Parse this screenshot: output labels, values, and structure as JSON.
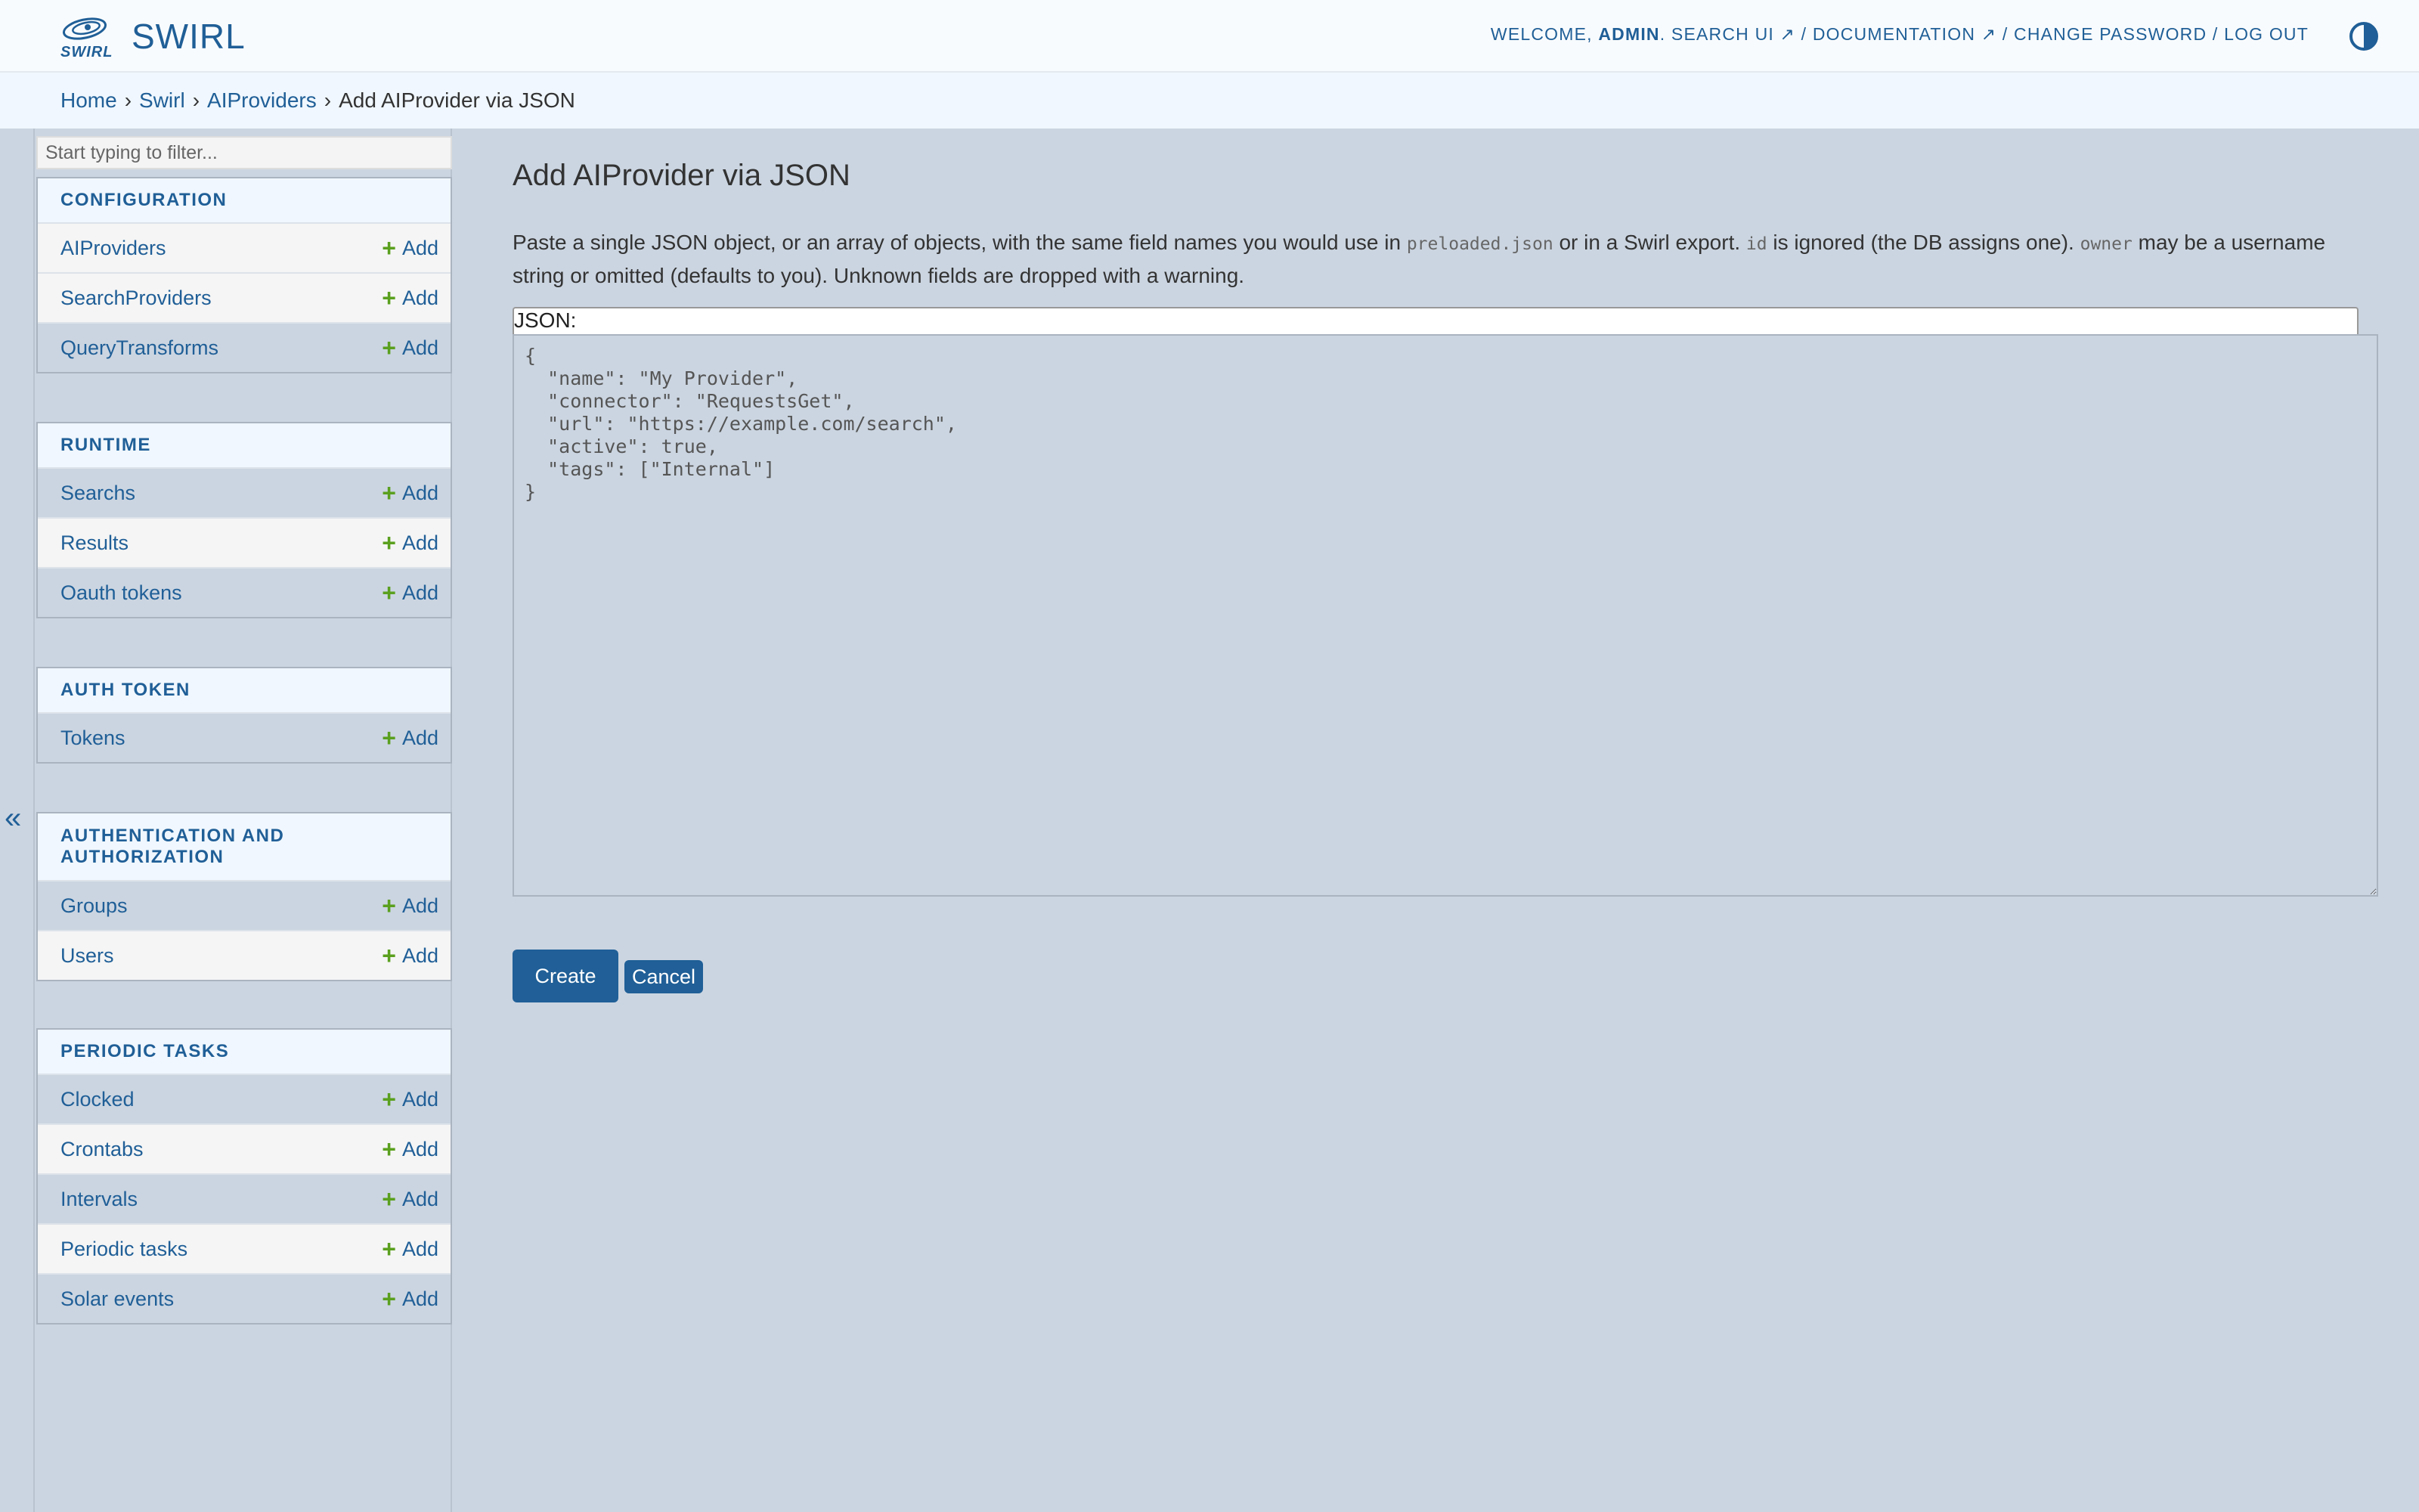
{
  "header": {
    "logo_text": "SWIRL",
    "site_title": "SWIRL",
    "welcome": "Welcome, ",
    "username": "admin",
    "search_ui": "Search UI ↗",
    "documentation": "Documentation ↗",
    "change_password": "Change password",
    "log_out": "Log out",
    "separator": " / "
  },
  "breadcrumbs": {
    "home": "Home",
    "app": "Swirl",
    "model": "AIProviders",
    "current": "Add AIProvider via JSON",
    "sep": "›"
  },
  "sidebar": {
    "filter_placeholder": "Start typing to filter...",
    "add_label": "Add",
    "collapse": "«",
    "modules": [
      {
        "caption": "Configuration",
        "items": [
          "AIProviders",
          "SearchProviders",
          "QueryTransforms"
        ]
      },
      {
        "caption": "Runtime",
        "items": [
          "Searchs",
          "Results",
          "Oauth tokens"
        ]
      },
      {
        "caption": "Auth Token",
        "items": [
          "Tokens"
        ]
      },
      {
        "caption": "Authentication and Authorization",
        "items": [
          "Groups",
          "Users"
        ]
      },
      {
        "caption": "Periodic Tasks",
        "items": [
          "Clocked",
          "Crontabs",
          "Intervals",
          "Periodic tasks",
          "Solar events"
        ]
      }
    ]
  },
  "main": {
    "title": "Add AIProvider via JSON",
    "help": {
      "part1": "Paste a single JSON object, or an array of objects, with the same field names you would use in ",
      "code1": "preloaded.json",
      "part2": " or in a Swirl export. ",
      "code2": "id",
      "part3": " is ignored (the DB assigns one). ",
      "code3": "owner",
      "part4": " may be a username string or omitted (defaults to you). Unknown fields are dropped with a warning."
    },
    "json_label": "JSON:",
    "json_placeholder": "{\n  \"name\": \"My Provider\",\n  \"connector\": \"RequestsGet\",\n  \"url\": \"https://example.com/search\",\n  \"active\": true,\n  \"tags\": [\"Internal\"]\n}",
    "create_label": "Create",
    "cancel_label": "Cancel"
  },
  "colors": {
    "brand": "#205f97",
    "add_icon": "#5aa01e",
    "background": "#cbd5e1",
    "header_bg": "#f8fbfd"
  }
}
